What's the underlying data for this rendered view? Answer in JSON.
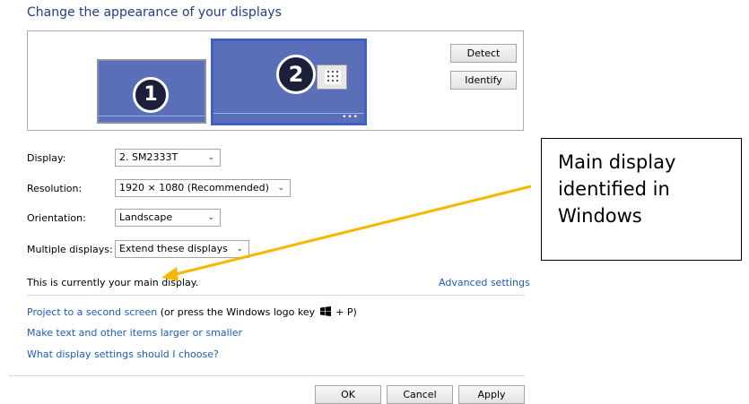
{
  "window": {
    "title": "Change the appearance of your displays"
  },
  "preview": {
    "monitor1_number": "1",
    "monitor2_number": "2",
    "more_dots": "•••"
  },
  "buttons": {
    "detect": "Detect",
    "identify": "Identify"
  },
  "settings": {
    "display_label": "Display:",
    "display_value": "2. SM2333T",
    "resolution_label": "Resolution:",
    "resolution_value": "1920 × 1080 (Recommended)",
    "orientation_label": "Orientation:",
    "orientation_value": "Landscape",
    "multiple_label": "Multiple displays:",
    "multiple_value": "Extend these displays"
  },
  "status": {
    "main_display_text": "This is currently your main display.",
    "advanced_link": "Advanced settings"
  },
  "links": {
    "project_link": "Project to a second screen",
    "project_hint_prefix": "(or press the Windows logo key",
    "project_hint_suffix": "+ P)",
    "text_size_link": "Make text and other items larger or smaller",
    "choose_link": "What display settings should I choose?"
  },
  "footer": {
    "ok": "OK",
    "cancel": "Cancel",
    "apply": "Apply"
  },
  "callout": {
    "text": "Main display\nidentified in\nWindows"
  },
  "icons": {
    "chevron": "chevron-down-icon",
    "windows": "windows-logo-icon",
    "grid": "taskbar-grid-icon"
  },
  "colors": {
    "accent_blue": "#1e3f8a",
    "link_blue": "#1a5bbd",
    "monitor_fill": "#5b6fb8",
    "selected_border": "#3e5fc9",
    "arrow": "#f5b800"
  }
}
